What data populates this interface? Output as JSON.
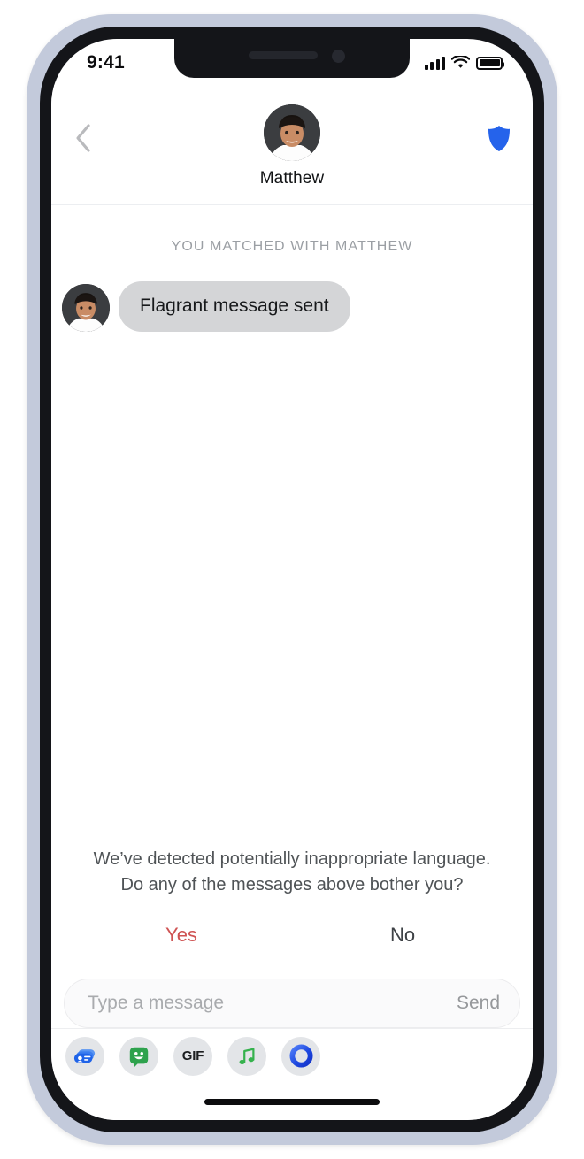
{
  "status_bar": {
    "time": "9:41",
    "signal_icon": "cellular-signal-icon",
    "wifi_icon": "wifi-icon",
    "battery_icon": "battery-full-icon"
  },
  "header": {
    "back_icon": "chevron-left-icon",
    "avatar_icon": "user-avatar-photo",
    "name": "Matthew",
    "shield_icon": "shield-icon",
    "shield_color": "#2563eb"
  },
  "conversation": {
    "match_banner": "YOU MATCHED WITH MATTHEW",
    "messages": [
      {
        "sender": "Matthew",
        "avatar_icon": "user-avatar-photo",
        "text": "Flagrant message sent",
        "side": "incoming",
        "bubble_color": "#d4d5d7"
      }
    ]
  },
  "moderation_prompt": {
    "line1": "We’ve detected potentially inappropriate language.",
    "line2": "Do any of the messages above bother you?",
    "yes_label": "Yes",
    "no_label": "No",
    "yes_color": "#cf5353",
    "no_color": "#3e4246"
  },
  "composer": {
    "placeholder": "Type a message",
    "value": "",
    "send_label": "Send"
  },
  "app_drawer": {
    "items": [
      {
        "name": "contact-card-icon",
        "label": "",
        "color": "#2c6ee8"
      },
      {
        "name": "memoji-sticker-icon",
        "label": "",
        "color": "#32a852"
      },
      {
        "name": "gif-icon",
        "label": "GIF",
        "color": "#1c1e20"
      },
      {
        "name": "music-note-icon",
        "label": "",
        "color": "#35b24d"
      },
      {
        "name": "digital-touch-icon",
        "label": "",
        "color": "#1d4fd8"
      }
    ]
  },
  "device": {
    "home_indicator": "home-indicator",
    "frame_color": "#c3cadb",
    "bezel_color": "#141519"
  }
}
